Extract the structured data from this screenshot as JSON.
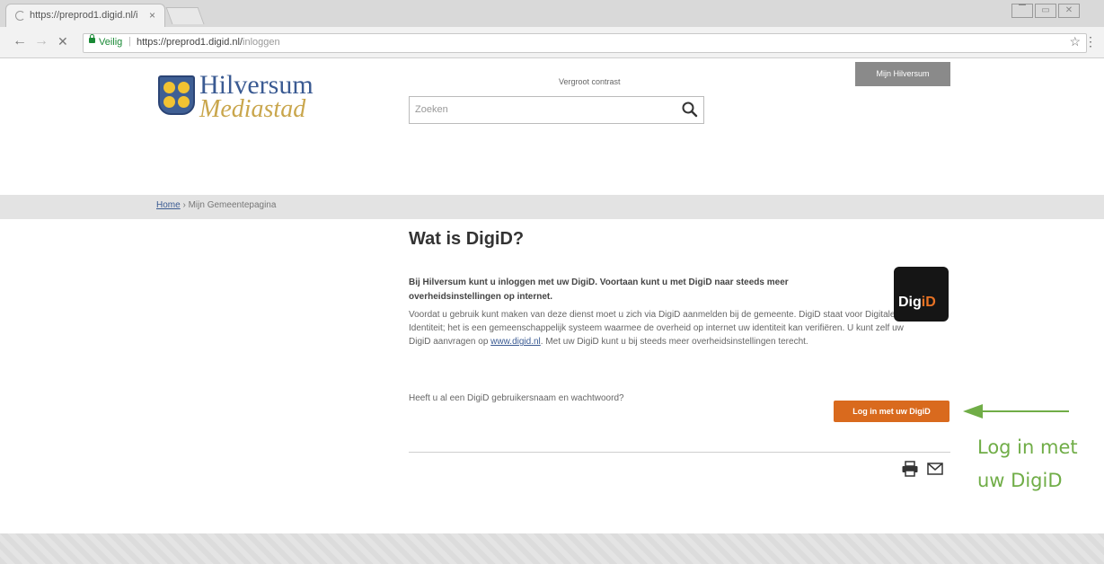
{
  "browser": {
    "tab_title": "https://preprod1.digid.nl/i",
    "tab_close": "×",
    "back": "←",
    "forward": "→",
    "stop": "✕",
    "secure_label": "Veilig",
    "separator": "|",
    "url_main": "https://preprod1.digid.nl/",
    "url_path": "inloggen",
    "bookmark_icon": "☆",
    "menu_icon": "⋮",
    "window_controls": [
      "▔",
      "▭",
      "✕"
    ]
  },
  "header": {
    "logo_title": "Hilversum",
    "logo_subtitle": "Mediastad",
    "contrast_link": "Vergroot contrast",
    "search_placeholder": "Zoeken",
    "mijn_button": "Mijn Hilversum"
  },
  "breadcrumb": {
    "home": "Home",
    "separator": "›",
    "current": "Mijn Gemeentepagina"
  },
  "main": {
    "title": "Wat is DigiD?",
    "intro": "Bij Hilversum kunt u inloggen met uw DigiD. Voortaan kunt u met DigiD naar steeds meer overheidsinstellingen op internet.",
    "body_1": "Voordat u gebruik kunt maken van deze dienst moet u zich via DigiD aanmelden bij de gemeente. DigiD staat voor Digitale Identiteit; het is een gemeenschappelijk systeem waarmee de overheid op internet uw identiteit kan verifiëren. U kunt zelf uw DigiD aanvragen op",
    "body_link": "www.digid.nl",
    "body_2": ". Met uw DigiD kunt u bij steeds meer overheidsinstellingen terecht.",
    "digid_logo_white": "Dig",
    "digid_logo_orange": "iD",
    "question": "Heeft u al een DigiD gebruikersnaam en wachtwoord?",
    "login_button": "Log in met uw DigiD"
  },
  "annotation": {
    "line1": "Log in met",
    "line2": "uw DigiD",
    "color": "#70ad47"
  },
  "colors": {
    "brand_blue": "#3a5a92",
    "brand_gold": "#c9a64c",
    "button_orange": "#d96a1e"
  }
}
